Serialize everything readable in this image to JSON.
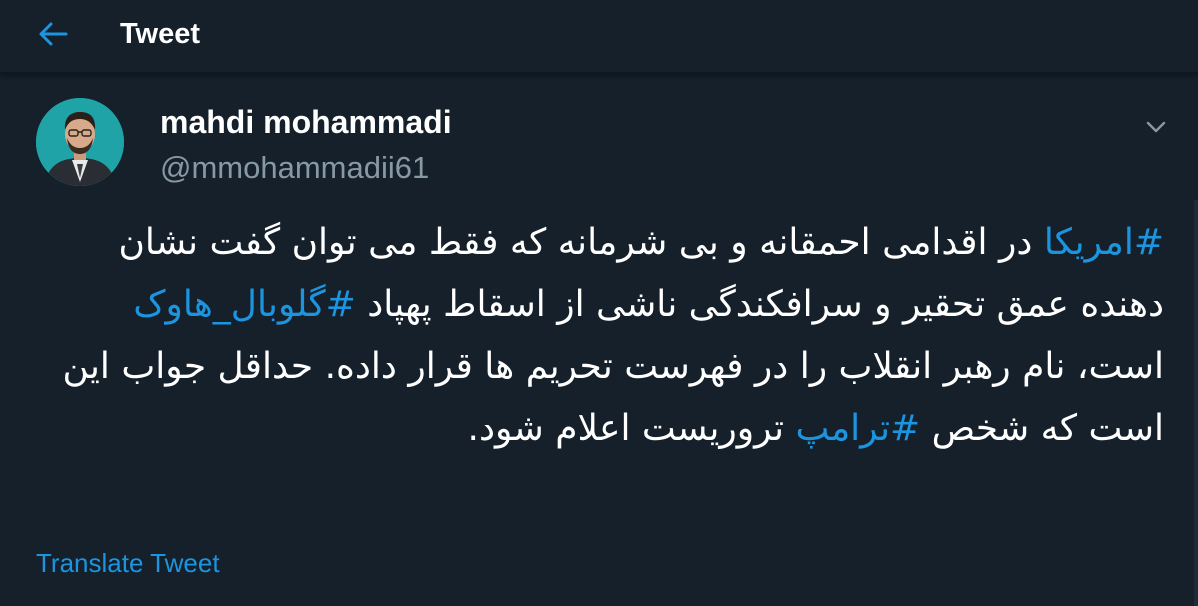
{
  "header": {
    "title": "Tweet",
    "back_icon": "back-arrow-icon"
  },
  "author": {
    "name": "mahdi mohammadi",
    "handle": "@mmohammadii61"
  },
  "tweet": {
    "lines": [
      [
        {
          "type": "hashtag",
          "text": "#امریکا"
        },
        {
          "type": "text",
          "text": " در اقدامی احمقانه و بی شرمانه که فقط می توان گفت نشان دهنده عمق تحقیر و سرافکندگی ناشی از اسقاط پهپاد "
        },
        {
          "type": "hashtag",
          "text": "#گلوبال_هاوک"
        },
        {
          "type": "text",
          "text": " است، نام رهبر انقلاب را در فهرست تحریم ها قرار داده. حداقل جواب این است که شخص "
        },
        {
          "type": "hashtag",
          "text": "#ترامپ"
        },
        {
          "type": "text",
          "text": " تروریست اعلام شود."
        }
      ]
    ]
  },
  "translate_label": "Translate Tweet",
  "colors": {
    "background": "#15202b",
    "accent": "#1b95e0",
    "secondary_text": "#8899a6"
  }
}
